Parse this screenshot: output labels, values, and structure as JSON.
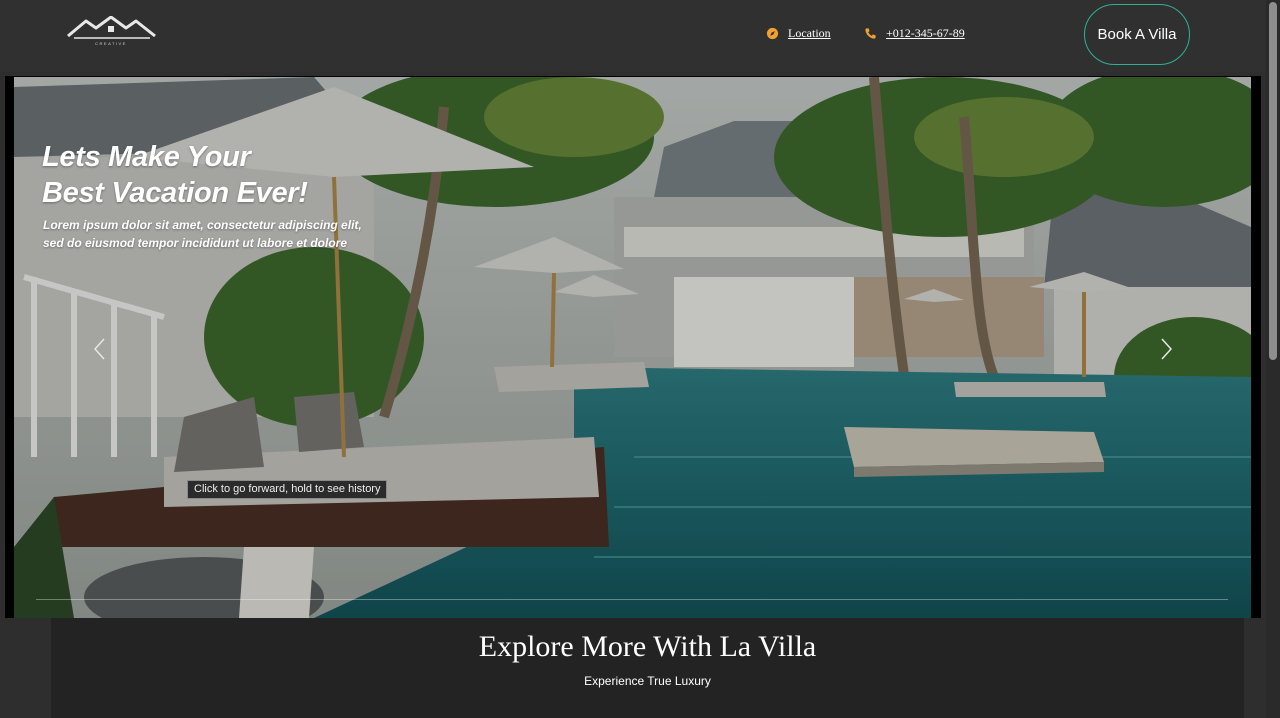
{
  "header": {
    "logo_text": "CREATIVE",
    "location_label": "Location",
    "phone_label": "+012-345-67-89",
    "book_button_label": "Book A Villa"
  },
  "hero": {
    "title_line1": "Lets Make Your",
    "title_line2": "Best Vacation Ever!",
    "subtitle_line1": "Lorem ipsum dolor sit amet, consectetur adipiscing elit,",
    "subtitle_line2": "sed do eiusmod tempor incididunt ut labore et dolore",
    "tooltip": "Click to go forward, hold to see history"
  },
  "section": {
    "title": "Explore More With La Villa",
    "subtitle": "Experience True Luxury"
  },
  "colors": {
    "accent_orange": "#f0a030",
    "button_border": "#2bb394",
    "header_bg": "#303030"
  }
}
